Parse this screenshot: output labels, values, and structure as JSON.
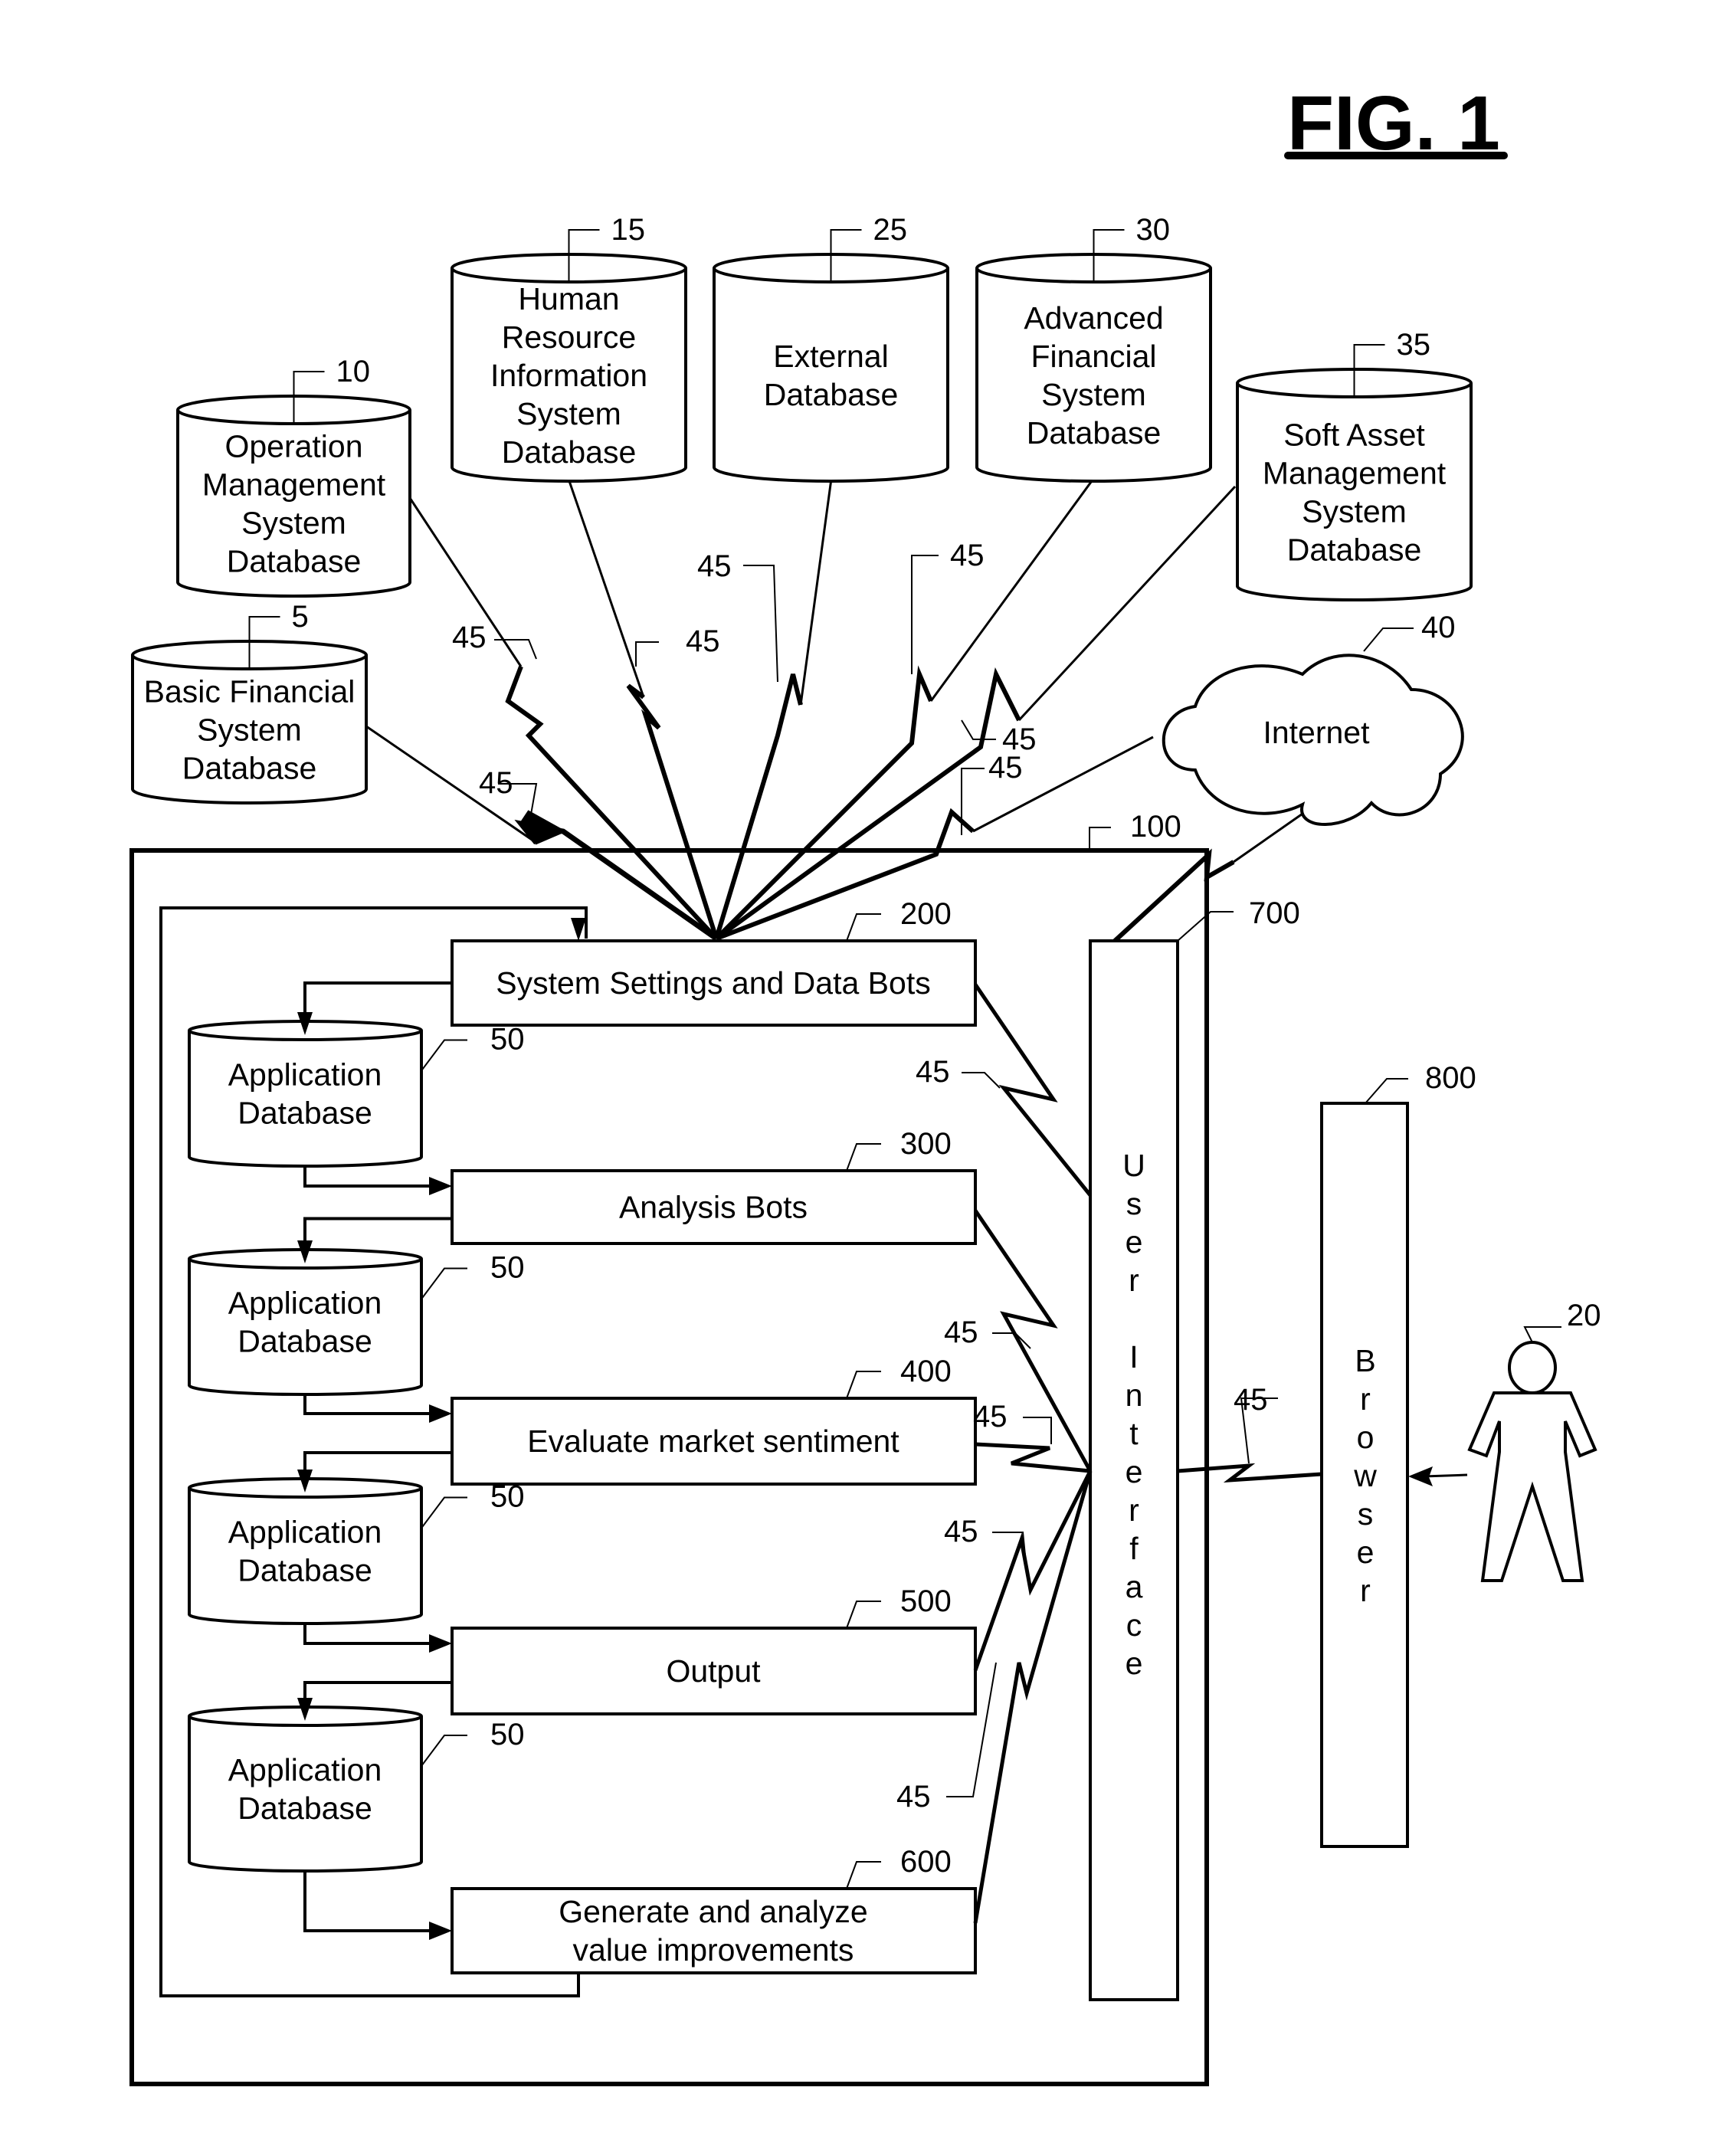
{
  "figure": {
    "title": "FIG. 1"
  },
  "external_databases": [
    {
      "id": "5",
      "lines": [
        "Basic Financial",
        "System",
        "Database"
      ]
    },
    {
      "id": "10",
      "lines": [
        "Operation",
        "Management",
        "System",
        "Database"
      ]
    },
    {
      "id": "15",
      "lines": [
        "Human",
        "Resource",
        "Information",
        "System",
        "Database"
      ]
    },
    {
      "id": "25",
      "lines": [
        "External",
        "Database"
      ]
    },
    {
      "id": "30",
      "lines": [
        "Advanced",
        "Financial",
        "System",
        "Database"
      ]
    },
    {
      "id": "35",
      "lines": [
        "Soft Asset",
        "Management",
        "System",
        "Database"
      ]
    }
  ],
  "internet": {
    "id": "40",
    "label": "Internet"
  },
  "connection_ref": "45",
  "system": {
    "id": "100"
  },
  "processes": [
    {
      "id": "200",
      "lines": [
        "System Settings and Data Bots"
      ]
    },
    {
      "id": "300",
      "lines": [
        "Analysis Bots"
      ]
    },
    {
      "id": "400",
      "lines": [
        "Evaluate market sentiment"
      ]
    },
    {
      "id": "500",
      "lines": [
        "Output"
      ]
    },
    {
      "id": "600",
      "lines": [
        "Generate and analyze",
        "value improvements"
      ]
    }
  ],
  "application_db": {
    "id": "50",
    "lines": [
      "Application",
      "Database"
    ]
  },
  "user_interface": {
    "id": "700",
    "letters": [
      "U",
      "s",
      "e",
      "r",
      "",
      "I",
      "n",
      "t",
      "e",
      "r",
      "f",
      "a",
      "c",
      "e"
    ]
  },
  "browser": {
    "id": "800",
    "letters": [
      "B",
      "r",
      "o",
      "w",
      "s",
      "e",
      "r"
    ]
  },
  "user": {
    "id": "20"
  }
}
